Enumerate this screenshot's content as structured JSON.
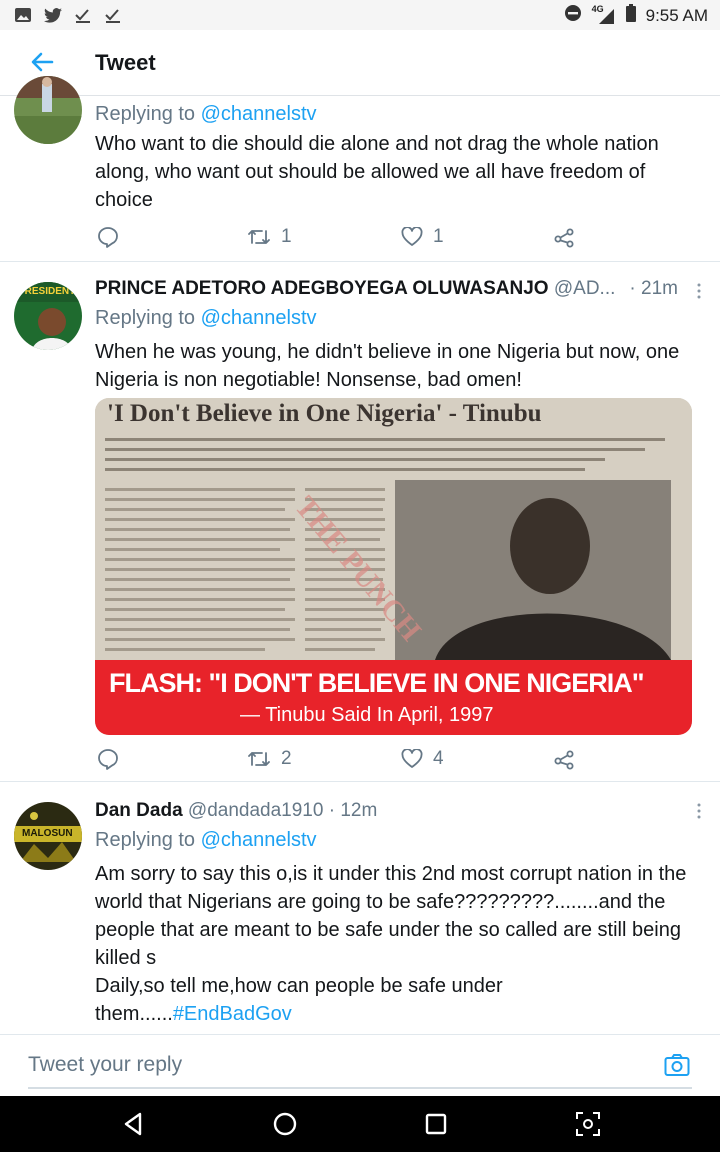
{
  "status_bar": {
    "network": "4G",
    "time": "9:55 AM",
    "icons": [
      "image-icon",
      "twitter-icon",
      "check-icon",
      "check-icon"
    ]
  },
  "header": {
    "title": "Tweet"
  },
  "tweets": [
    {
      "reply_label": "Replying to",
      "mention": "@channelstv",
      "text": "Who want to die should die alone and not drag the whole nation along, who want out should be allowed we all have freedom of choice",
      "retweets": "1",
      "likes": "1"
    },
    {
      "name": "PRINCE ADETORO ADEGBOYEGA OLUWASANJO",
      "handle": "@AD...",
      "time": "· 21m",
      "reply_label": "Replying to",
      "mention": "@channelstv",
      "text": "When he was young, he didn't believe in one Nigeria but now, one Nigeria is non negotiable! Nonsense, bad omen!",
      "image": {
        "headline": "'I Don't Believe in One Nigeria' - Tinubu",
        "banner": "FLASH: \"I DON'T BELIEVE IN ONE NIGERIA\"",
        "banner_sub": "— Tinubu Said In April, 1997"
      },
      "avatar_text": "PRESIDENT",
      "retweets": "2",
      "likes": "4"
    },
    {
      "name": "Dan Dada",
      "handle": "@dandada1910",
      "time": "· 12m",
      "reply_label": "Replying to",
      "mention": "@channelstv",
      "text": "Am sorry to say this o,is it under this 2nd most corrupt nation in the world that Nigerians are going to be safe?????????........and the people that are meant to be safe under the so called are still being killed s",
      "text2": "Daily,so tell me,how can people be safe under them......",
      "hashtag": "#EndBadGov",
      "avatar_text": "MALOSUN"
    }
  ],
  "reply_bar": {
    "placeholder": "Tweet your reply"
  },
  "colors": {
    "accent": "#1da1f2",
    "muted": "#657786",
    "text": "#14171a",
    "banner_red": "#e8232a"
  }
}
